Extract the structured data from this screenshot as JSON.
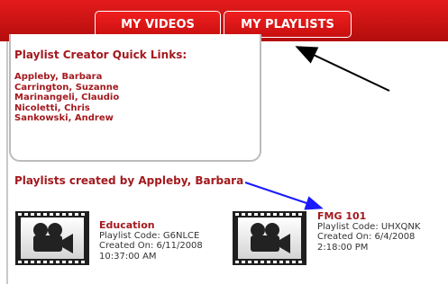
{
  "nav": {
    "tabs": [
      {
        "label": "MY VIDEOS"
      },
      {
        "label": "MY PLAYLISTS"
      }
    ]
  },
  "quick_links": {
    "title": "Playlist Creator Quick Links:",
    "items": [
      "Appleby, Barbara",
      "Carrington, Suzanne",
      "Marinangeli, Claudio",
      "Nicoletti, Chris",
      "Sankowski, Andrew"
    ]
  },
  "playlists_heading": "Playlists created by Appleby, Barbara",
  "playlists": [
    {
      "name": "Education",
      "code": "Playlist Code: G6NLCE",
      "created_date": "Created On: 6/11/2008",
      "created_time": "10:37:00 AM",
      "icon": "film-camera-icon"
    },
    {
      "name": "FMG 101",
      "code": "Playlist Code: UHXQNK",
      "created_date": "Created On: 6/4/2008",
      "created_time": "2:18:00 PM",
      "icon": "film-camera-icon"
    }
  ],
  "colors": {
    "accent": "#a3191e",
    "nav": "#d11414"
  }
}
